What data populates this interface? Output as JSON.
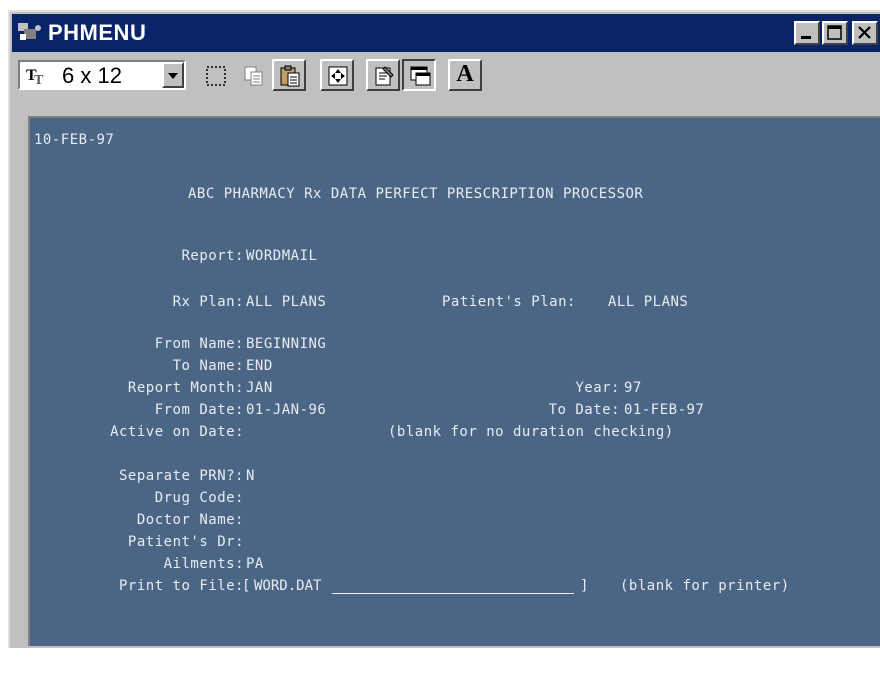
{
  "window": {
    "title": "PHMENU"
  },
  "toolbar": {
    "font_size": "6 x 12",
    "text_button": "A"
  },
  "screen": {
    "date": "10-FEB-97",
    "heading": "ABC PHARMACY Rx DATA PERFECT PRESCRIPTION PROCESSOR",
    "report_label": "Report:",
    "report_value": "WORDMAIL",
    "rx_plan_label": "Rx Plan:",
    "rx_plan_value": "ALL PLANS",
    "patient_plan_label": "Patient's Plan:",
    "patient_plan_value": "ALL PLANS",
    "from_name_label": "From Name:",
    "from_name_value": "BEGINNING",
    "to_name_label": "To Name:",
    "to_name_value": "END",
    "report_month_label": "Report Month:",
    "report_month_value": "JAN",
    "year_label": "Year:",
    "year_value": "97",
    "from_date_label": "From Date:",
    "from_date_value": "01-JAN-96",
    "to_date_label": "To Date:",
    "to_date_value": "01-FEB-97",
    "active_on_date_label": "Active on Date:",
    "active_on_date_hint": "(blank for no duration checking)",
    "separate_prn_label": "Separate PRN?:",
    "separate_prn_value": "N",
    "drug_code_label": "Drug Code:",
    "doctor_name_label": "Doctor Name:",
    "patients_dr_label": "Patient's Dr:",
    "ailments_label": "Ailments:",
    "ailments_value": "PA",
    "print_to_file_label": "Print to File:",
    "print_to_file_value": "WORD.DAT",
    "print_to_file_hint": "(blank for printer)"
  }
}
